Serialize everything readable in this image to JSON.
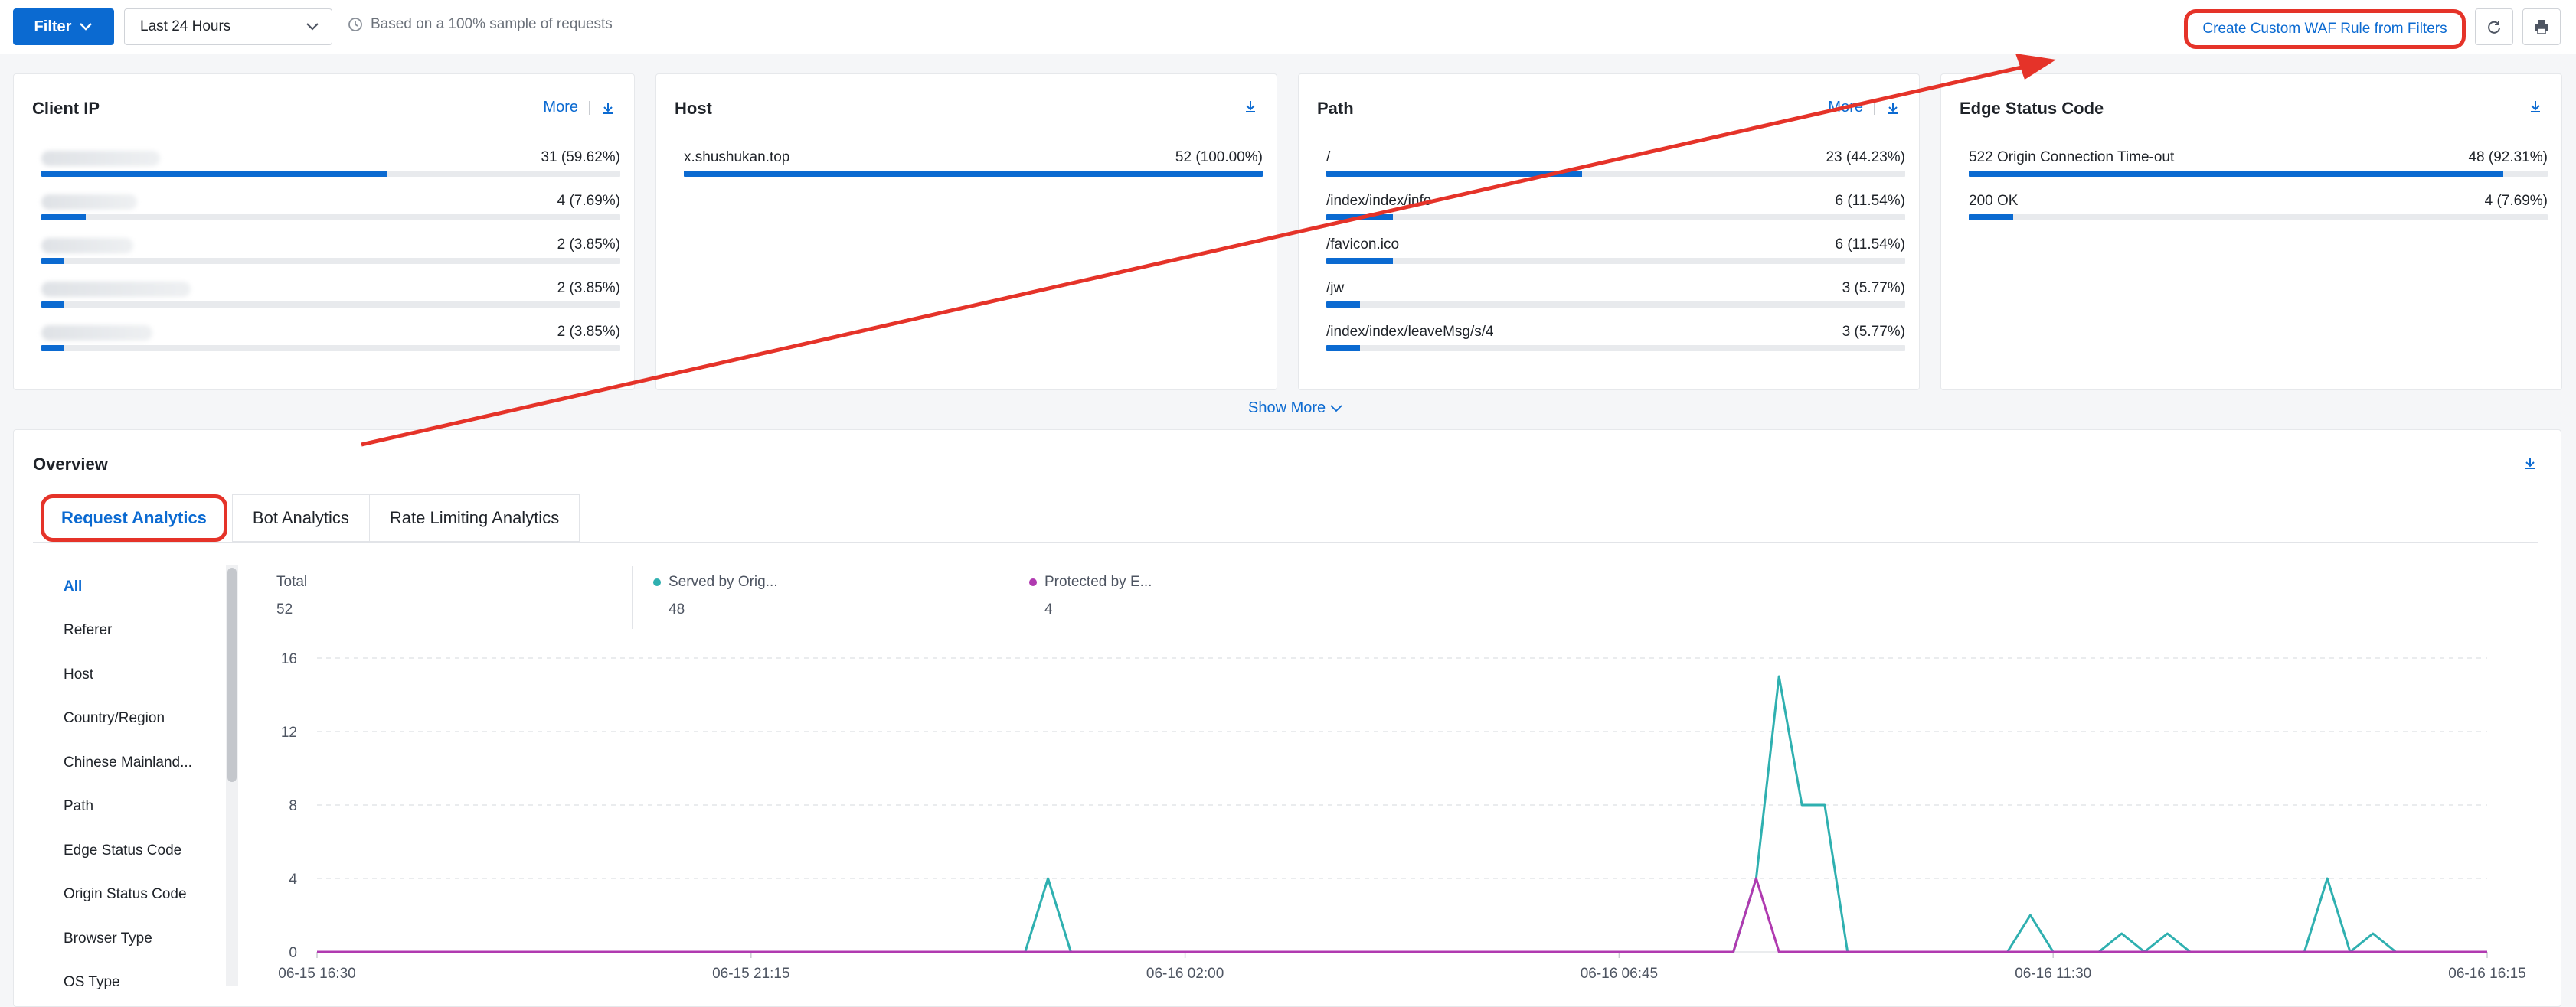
{
  "topbar": {
    "filter_label": "Filter",
    "time_range": "Last 24 Hours",
    "sample_note": "Based on a 100% sample of requests",
    "waf_button": "Create Custom WAF Rule from Filters"
  },
  "cards": [
    {
      "title": "Client IP",
      "more": "More",
      "rows": [
        {
          "label": "",
          "value": "31 (59.62%)",
          "fraction": 0.5962
        },
        {
          "label": "",
          "value": "4 (7.69%)",
          "fraction": 0.0769
        },
        {
          "label": "",
          "value": "2 (3.85%)",
          "fraction": 0.0385
        },
        {
          "label": "",
          "value": "2 (3.85%)",
          "fraction": 0.0385
        },
        {
          "label": "",
          "value": "2 (3.85%)",
          "fraction": 0.0385
        }
      ]
    },
    {
      "title": "Host",
      "more": "",
      "rows": [
        {
          "label": "x.shushukan.top",
          "value": "52 (100.00%)",
          "fraction": 1.0
        }
      ]
    },
    {
      "title": "Path",
      "more": "More",
      "rows": [
        {
          "label": "/",
          "value": "23 (44.23%)",
          "fraction": 0.4423
        },
        {
          "label": "/index/index/info",
          "value": "6 (11.54%)",
          "fraction": 0.1154
        },
        {
          "label": "/favicon.ico",
          "value": "6 (11.54%)",
          "fraction": 0.1154
        },
        {
          "label": "/jw",
          "value": "3 (5.77%)",
          "fraction": 0.0577
        },
        {
          "label": "/index/index/leaveMsg/s/4",
          "value": "3 (5.77%)",
          "fraction": 0.0577
        }
      ]
    },
    {
      "title": "Edge Status Code",
      "more": "",
      "rows": [
        {
          "label": "522 Origin Connection Time-out",
          "value": "48 (92.31%)",
          "fraction": 0.9231
        },
        {
          "label": "200 OK",
          "value": "4 (7.69%)",
          "fraction": 0.0769
        }
      ]
    }
  ],
  "show_more": "Show More",
  "overview": {
    "title": "Overview",
    "tabs": [
      "Request Analytics",
      "Bot Analytics",
      "Rate Limiting Analytics"
    ],
    "sidebar": [
      "All",
      "Referer",
      "Host",
      "Country/Region",
      "Chinese Mainland...",
      "Path",
      "Edge Status Code",
      "Origin Status Code",
      "Browser Type",
      "OS Type"
    ],
    "stats": [
      {
        "label": "Total",
        "value": "52"
      },
      {
        "label": "Served by Orig...",
        "value": "48"
      },
      {
        "label": "Protected by E...",
        "value": "4"
      }
    ]
  },
  "colors": {
    "accent": "#0b6ad1",
    "annotation": "#e53329",
    "origin_series": "#2fb0b0",
    "protected_series": "#b03ab0"
  },
  "chart_data": {
    "type": "line",
    "x_ticks": [
      "06-15 16:30",
      "06-15 21:15",
      "06-16 02:00",
      "06-16 06:45",
      "06-16 11:30",
      "06-16 16:15"
    ],
    "x_range": [
      "06-15 16:30",
      "06-16 16:15"
    ],
    "y_ticks": [
      "0",
      "4",
      "8",
      "12",
      "16"
    ],
    "ylim": [
      0,
      16
    ],
    "grid": true,
    "series": [
      {
        "name": "Served by Orig...",
        "color": "#2fb0b0",
        "points": [
          [
            "06-15 16:30",
            0
          ],
          [
            "06-16 00:15",
            0
          ],
          [
            "06-16 00:30",
            4
          ],
          [
            "06-16 00:45",
            0
          ],
          [
            "06-16 08:00",
            0
          ],
          [
            "06-16 08:15",
            4
          ],
          [
            "06-16 08:30",
            15
          ],
          [
            "06-16 08:45",
            8
          ],
          [
            "06-16 09:00",
            8
          ],
          [
            "06-16 09:15",
            0
          ],
          [
            "06-16 11:00",
            0
          ],
          [
            "06-16 11:15",
            2
          ],
          [
            "06-16 11:30",
            0
          ],
          [
            "06-16 12:00",
            0
          ],
          [
            "06-16 12:15",
            1
          ],
          [
            "06-16 12:30",
            0
          ],
          [
            "06-16 12:45",
            1
          ],
          [
            "06-16 13:00",
            0
          ],
          [
            "06-16 14:15",
            0
          ],
          [
            "06-16 14:30",
            4
          ],
          [
            "06-16 14:45",
            0
          ],
          [
            "06-16 15:00",
            1
          ],
          [
            "06-16 15:15",
            0
          ],
          [
            "06-16 16:15",
            0
          ]
        ]
      },
      {
        "name": "Protected by E...",
        "color": "#b03ab0",
        "points": [
          [
            "06-15 16:30",
            0
          ],
          [
            "06-16 08:00",
            0
          ],
          [
            "06-16 08:15",
            4
          ],
          [
            "06-16 08:30",
            0
          ],
          [
            "06-16 16:15",
            0
          ]
        ]
      }
    ]
  }
}
